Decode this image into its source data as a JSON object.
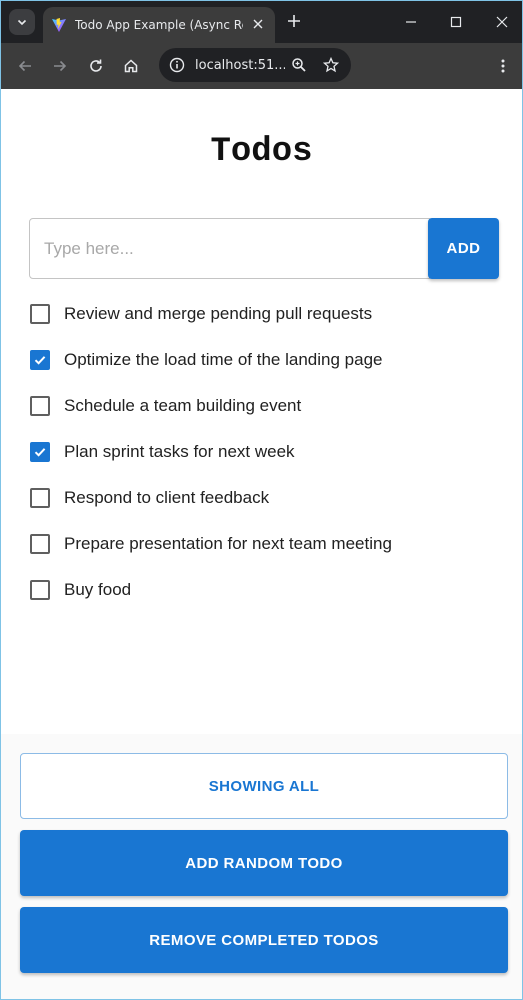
{
  "browser": {
    "tab_title": "Todo App Example (Async Redux)",
    "address": "localhost:51...",
    "accent": "#202124"
  },
  "app": {
    "title": "Todos",
    "input": {
      "value": "",
      "placeholder": "Type here..."
    },
    "add_label": "ADD",
    "accent": "#1976d2",
    "todos": [
      {
        "text": "Review and merge pending pull requests",
        "checked": false
      },
      {
        "text": "Optimize the load time of the landing page",
        "checked": true
      },
      {
        "text": "Schedule a team building event",
        "checked": false
      },
      {
        "text": "Plan sprint tasks for next week",
        "checked": true
      },
      {
        "text": "Respond to client feedback",
        "checked": false
      },
      {
        "text": "Prepare presentation for next team meeting",
        "checked": false
      },
      {
        "text": "Buy food",
        "checked": false
      }
    ],
    "filter_label": "SHOWING ALL",
    "add_random_label": "ADD RANDOM TODO",
    "remove_completed_label": "REMOVE COMPLETED TODOS"
  }
}
